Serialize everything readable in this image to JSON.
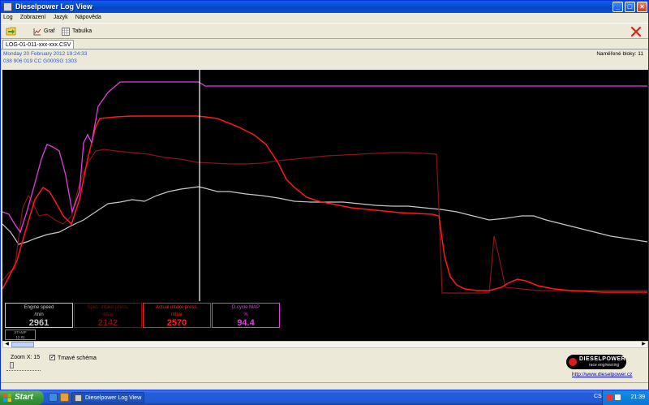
{
  "window": {
    "title": "Dieselpower Log View"
  },
  "menu": [
    "Log",
    "Zobrazení",
    "Jazyk",
    "Nápověda"
  ],
  "toolbar": {
    "graph_label": "Graf",
    "table_label": "Tabulka"
  },
  "tab": {
    "label": "LOG-01-011-xxx-xxx.CSV"
  },
  "info": {
    "date": "Monday 20 February 2012 19:24:33",
    "ecu": "038 906 019 CC  G000SG  1303",
    "blocks": "Naměřené bloky: 11"
  },
  "gauges": [
    {
      "name": "Engine speed",
      "unit": "/min",
      "value": "2961",
      "color": "#c8c8c8"
    },
    {
      "name": "Spec. intake press.",
      "unit": "mbar",
      "value": "2142",
      "color": "#7a1010"
    },
    {
      "name": "Actual intake press.",
      "unit": "mbar",
      "value": "2570",
      "color": "#ff2020"
    },
    {
      "name": "D.cycle MAP",
      "unit": "%",
      "value": "94.4",
      "color": "#e040e0"
    }
  ],
  "stamp": {
    "line1": "STAMP",
    "line2": "12.81"
  },
  "bottom": {
    "zoom": "Zoom X: 15",
    "dark_scheme": "Tmavé schéma",
    "website": "http://www.dieselpower.cz"
  },
  "logo": {
    "brand": "DIESELPOWER",
    "tagline": "race engineering"
  },
  "taskbar": {
    "start": "Start",
    "task": "Dieselpower Log View",
    "lang": "CS",
    "clock": "21:39"
  },
  "colors": {
    "engine_speed": "#c8c8c8",
    "spec_press": "#8a1515",
    "actual_press": "#ff1a1a",
    "map": "#e040e0",
    "cursor": "#ffffff"
  }
}
